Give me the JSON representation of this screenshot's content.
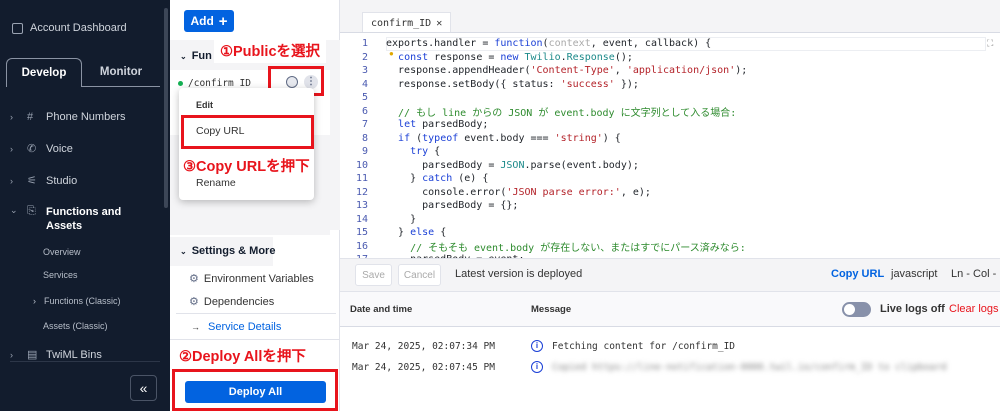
{
  "sidebar": {
    "account_dashboard": "Account Dashboard",
    "tabs": [
      "Develop",
      "Monitor"
    ],
    "items": [
      {
        "label": "Phone Numbers",
        "icon": "hash-icon",
        "glyph": "#"
      },
      {
        "label": "Voice",
        "icon": "phone-icon",
        "glyph": "✆"
      },
      {
        "label": "Studio",
        "icon": "studio-icon",
        "glyph": "⚟"
      }
    ],
    "functions_label": "Functions and Assets",
    "functions_line1": "Functions and",
    "functions_line2": "Assets",
    "sub_items": [
      "Overview",
      "Services",
      "Functions (Classic)",
      "Assets (Classic)"
    ],
    "twiml_bins": "TwiML Bins",
    "collapse": "«"
  },
  "mid": {
    "add_label": "Add",
    "add_plus": "+",
    "functions_header": "Fun",
    "function_item": "/confirm_ID",
    "menu": [
      "Edit",
      "Copy URL",
      "Rename"
    ],
    "settings_header": "Settings & More",
    "settings_items": [
      "Environment Variables",
      "Dependencies"
    ],
    "service_details": "Service Details",
    "deploy_all": "Deploy All"
  },
  "annotations": {
    "step1": "①Publicを選択",
    "step2": "②Deploy Allを押下",
    "step3": "③Copy URLを押下"
  },
  "editor": {
    "tab_label": "confirm_ID",
    "tab_close": "✕",
    "lines": [
      [
        [
          "",
          "exports.handler = "
        ],
        [
          "k",
          "function"
        ],
        [
          "",
          "("
        ],
        [
          "p",
          "context"
        ],
        [
          "",
          ", event, callback) {"
        ]
      ],
      [
        [
          "",
          "  "
        ],
        [
          "k",
          "const"
        ],
        [
          "",
          " response = "
        ],
        [
          "k",
          "new"
        ],
        [
          "",
          " "
        ],
        [
          "t",
          "Twilio"
        ],
        [
          "",
          "."
        ],
        [
          "t",
          "Response"
        ],
        [
          "",
          "();"
        ]
      ],
      [
        [
          "",
          "  response.appendHeader("
        ],
        [
          "s",
          "'Content-Type'"
        ],
        [
          "",
          ", "
        ],
        [
          "s",
          "'application/json'"
        ],
        [
          "",
          ");"
        ]
      ],
      [
        [
          "",
          "  response.setBody({ status: "
        ],
        [
          "s",
          "'success'"
        ],
        [
          "",
          " });"
        ]
      ],
      [
        [
          "",
          ""
        ]
      ],
      [
        [
          "c",
          "  // もし line からの JSON が event.body に文字列として入る場合:"
        ]
      ],
      [
        [
          "",
          "  "
        ],
        [
          "k",
          "let"
        ],
        [
          "",
          " parsedBody;"
        ]
      ],
      [
        [
          "",
          "  "
        ],
        [
          "k",
          "if"
        ],
        [
          "",
          " ("
        ],
        [
          "k",
          "typeof"
        ],
        [
          "",
          " event.body === "
        ],
        [
          "s",
          "'string'"
        ],
        [
          "",
          ") {"
        ]
      ],
      [
        [
          "",
          "    "
        ],
        [
          "k",
          "try"
        ],
        [
          "",
          " {"
        ]
      ],
      [
        [
          "",
          "      parsedBody = "
        ],
        [
          "t",
          "JSON"
        ],
        [
          "",
          ".parse(event.body);"
        ]
      ],
      [
        [
          "",
          "    } "
        ],
        [
          "k",
          "catch"
        ],
        [
          "",
          " (e) {"
        ]
      ],
      [
        [
          "",
          "      console.error("
        ],
        [
          "s",
          "'JSON parse error:'"
        ],
        [
          "",
          ", e);"
        ]
      ],
      [
        [
          "",
          "      parsedBody = {};"
        ]
      ],
      [
        [
          "",
          "    }"
        ]
      ],
      [
        [
          "",
          "  } "
        ],
        [
          "k",
          "else"
        ],
        [
          "",
          " {"
        ]
      ],
      [
        [
          "c",
          "    // そもそも event.body が存在しない、またはすでにパース済みなら:"
        ]
      ],
      [
        [
          "",
          "    parsedBody = event;"
        ]
      ]
    ],
    "toolbar": {
      "save": "Save",
      "cancel": "Cancel",
      "status": "Latest version is deployed",
      "copy_url": "Copy URL",
      "language": "javascript",
      "position": "Ln - Col -"
    }
  },
  "logs": {
    "col_date": "Date and time",
    "col_message": "Message",
    "live_logs": "Live logs off",
    "live_logs_on": false,
    "clear_logs": "Clear logs",
    "rows": [
      {
        "time": "Mar 24, 2025, 02:07:34 PM",
        "message": "Fetching content for /confirm_ID",
        "blurred": false
      },
      {
        "time": "Mar 24, 2025, 02:07:45 PM",
        "message": "Copied https://line-notification-0000.twil.io/confirm_ID to clipboard",
        "blurred": true
      }
    ]
  },
  "colors": {
    "accent": "#0263e0",
    "annotation": "#e8141c",
    "sidebar_bg": "#121c2d"
  }
}
